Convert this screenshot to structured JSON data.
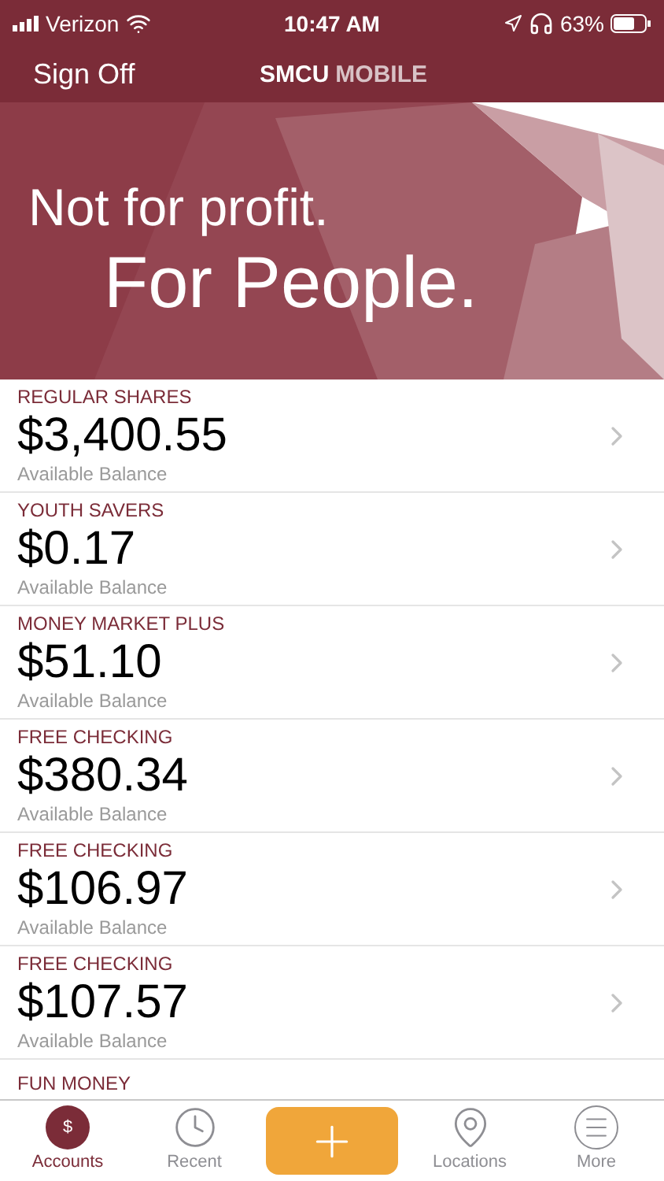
{
  "status_bar": {
    "carrier": "Verizon",
    "time": "10:47 AM",
    "battery": "63%"
  },
  "nav_bar": {
    "left_button": "Sign Off",
    "title_bold": "SMCU",
    "title_light": "MOBILE"
  },
  "banner": {
    "line_1": "Not for profit.",
    "line_2": "For People."
  },
  "accounts": [
    {
      "name": "REGULAR SHARES",
      "amount": "$3,400.55",
      "caption": "Available Balance"
    },
    {
      "name": "YOUTH SAVERS",
      "amount": "$0.17",
      "caption": "Available Balance"
    },
    {
      "name": "MONEY MARKET PLUS",
      "amount": "$51.10",
      "caption": "Available Balance"
    },
    {
      "name": "FREE CHECKING",
      "amount": "$380.34",
      "caption": "Available Balance"
    },
    {
      "name": "FREE CHECKING",
      "amount": "$106.97",
      "caption": "Available Balance"
    },
    {
      "name": "FREE CHECKING",
      "amount": "$107.57",
      "caption": "Available Balance"
    }
  ],
  "partial_account": {
    "name": "FUN MONEY"
  },
  "tab_bar": [
    {
      "kind": "accounts",
      "label": "Accounts",
      "icon_text": "$",
      "selected": true
    },
    {
      "kind": "recent",
      "label": "Recent",
      "selected": false
    },
    {
      "kind": "add",
      "selected": false
    },
    {
      "kind": "locations",
      "label": "Locations",
      "selected": false
    },
    {
      "kind": "more",
      "label": "More",
      "selected": false
    }
  ]
}
